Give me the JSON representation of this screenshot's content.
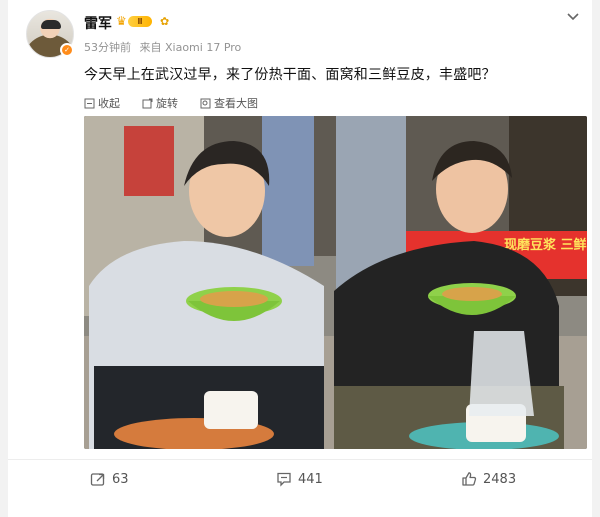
{
  "post": {
    "author": "雷军",
    "vip_level": "Ⅱ",
    "time": "53分钟前",
    "source": "来自 Xiaomi 17 Pro",
    "text": "今天早上在武汉过早，来了份热干面、面窝和三鲜豆皮，丰盛吧？"
  },
  "actions": {
    "favorite": "收起",
    "rotate": "旋转",
    "view_large": "查看大图"
  },
  "photo": {
    "sign_text": "现磨豆浆 三鲜豆汤"
  },
  "footer": {
    "repost_count": "63",
    "comment_count": "441",
    "like_count": "2483"
  },
  "icons": {
    "expand": "chevron-down-icon",
    "repost": "share-icon",
    "comment": "comment-icon",
    "like": "thumbs-up-icon"
  },
  "colors": {
    "vip_gold": "#ffb300",
    "verify_orange": "#ff8c1a",
    "bowl_green": "#7ec43a",
    "sign_red": "#e5322d"
  }
}
